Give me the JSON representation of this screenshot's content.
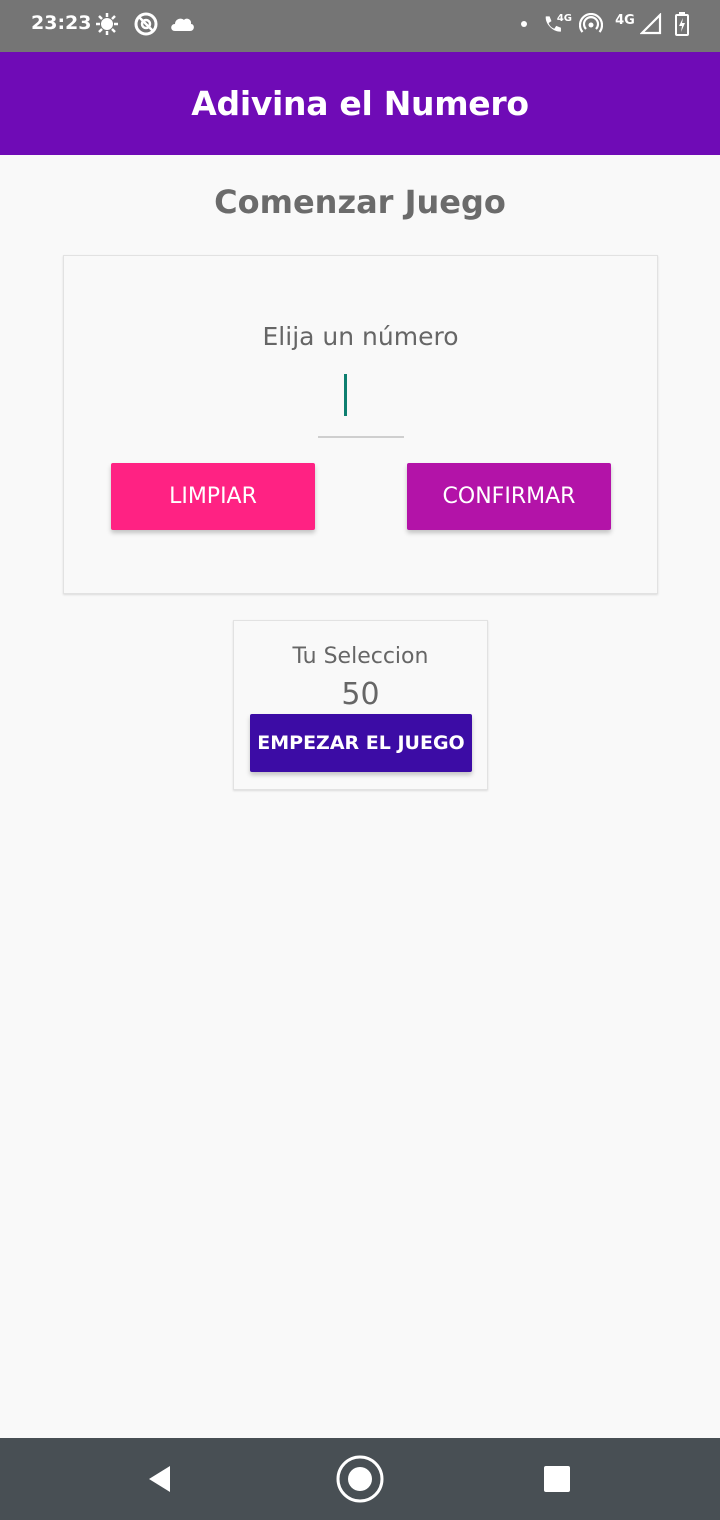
{
  "status_bar": {
    "time": "23:23",
    "left_icons": [
      "weather-icon",
      "circle-slash-icon",
      "cloud-icon"
    ],
    "right_icons": [
      "dot-icon",
      "volte-icon",
      "hotspot-icon",
      "signal-icon",
      "battery-icon"
    ],
    "network_labels": [
      "4G",
      "4G"
    ]
  },
  "app_bar": {
    "title": "Adivina el Numero",
    "color": "#6f0bb6"
  },
  "screen": {
    "title": "Comenzar Juego",
    "prompt": "Elija un número",
    "input_value": "",
    "clear_label": "LIMPIAR",
    "confirm_label": "CONFIRMAR",
    "clear_color": "#ff2283",
    "confirm_color": "#b313a8"
  },
  "selection": {
    "label": "Tu Seleccion",
    "value": "50",
    "start_label": "EMPEZAR EL JUEGO",
    "start_color": "#3c0ca5"
  },
  "nav_bar": {
    "buttons": [
      "back-icon",
      "home-icon",
      "recents-icon"
    ]
  }
}
